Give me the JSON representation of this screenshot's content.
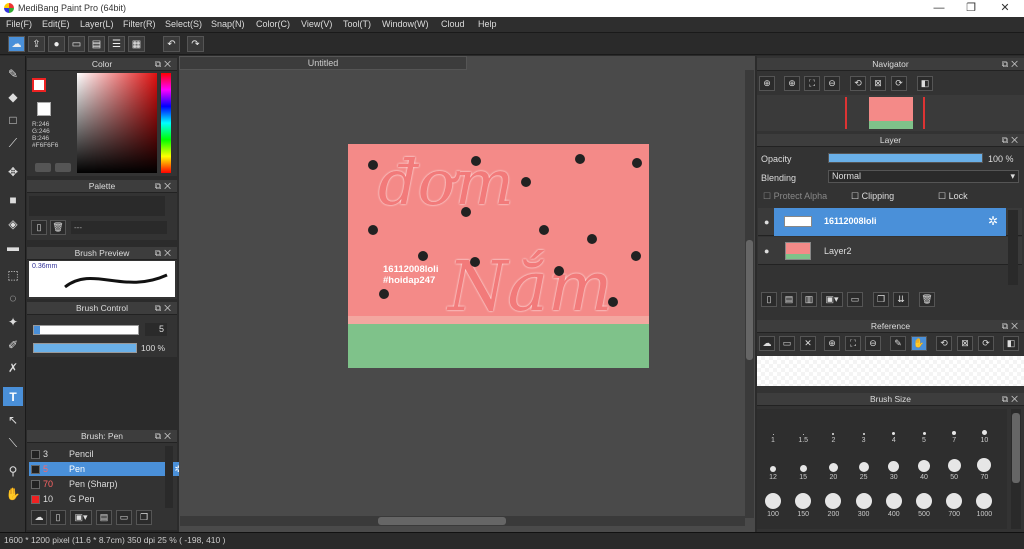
{
  "window": {
    "title": "MediBang Paint Pro (64bit)"
  },
  "menu": [
    "File(F)",
    "Edit(E)",
    "Layer(L)",
    "Filter(R)",
    "Select(S)",
    "Snap(N)",
    "Color(C)",
    "View(V)",
    "Tool(T)",
    "Window(W)",
    "Cloud",
    "Help"
  ],
  "panels": {
    "color": {
      "title": "Color",
      "fg": "#ee2222",
      "bg": "#ffffff",
      "r": "R:246",
      "g": "G:246",
      "b": "B:246",
      "hex": "#F6F6F6"
    },
    "palette": {
      "title": "Palette",
      "placeholder": "---"
    },
    "brush_preview": {
      "title": "Brush Preview",
      "size": "0.36mm"
    },
    "brush_control": {
      "title": "Brush Control",
      "size_value": "5",
      "opacity_value": "100 %"
    },
    "brush_list": {
      "title": "Brush: Pen",
      "items": [
        {
          "size": "3",
          "name": "Pencil",
          "color": "#222222"
        },
        {
          "size": "5",
          "name": "Pen",
          "color": "#222222",
          "selected": true
        },
        {
          "size": "70",
          "name": "Pen (Sharp)",
          "color": "#222222"
        },
        {
          "size": "10",
          "name": "G Pen",
          "color": "#ee2222"
        }
      ]
    },
    "navigator": {
      "title": "Navigator"
    },
    "layer": {
      "title": "Layer",
      "opacity_label": "Opacity",
      "opacity_value": "100 %",
      "opacity_fraction": 1.0,
      "blending_label": "Blending",
      "blending_value": "Normal",
      "protect_alpha": "Protect Alpha",
      "clipping": "Clipping",
      "lock": "Lock",
      "layers": [
        {
          "name": "16112008loli",
          "selected": true
        },
        {
          "name": "Layer2",
          "selected": false
        }
      ]
    },
    "reference": {
      "title": "Reference"
    },
    "brush_size": {
      "title": "Brush Size",
      "sizes": [
        "1",
        "1.5",
        "2",
        "3",
        "4",
        "5",
        "7",
        "10",
        "12",
        "15",
        "20",
        "25",
        "30",
        "40",
        "50",
        "70",
        "100",
        "150",
        "200",
        "300",
        "400",
        "500",
        "700",
        "1000"
      ]
    }
  },
  "document": {
    "tab": "Untitled",
    "art_text_top": "đơm",
    "art_text_bottom": "Nắm",
    "art_caption_1": "16112008loli",
    "art_caption_2": "#hoidap247",
    "art_bg": "#f48a88",
    "art_ground": "#7fc28a"
  },
  "status": {
    "text": "1600 * 1200 pixel   (11.6 * 8.7cm)   350 dpi   25 %   ( -198, 410 )"
  }
}
